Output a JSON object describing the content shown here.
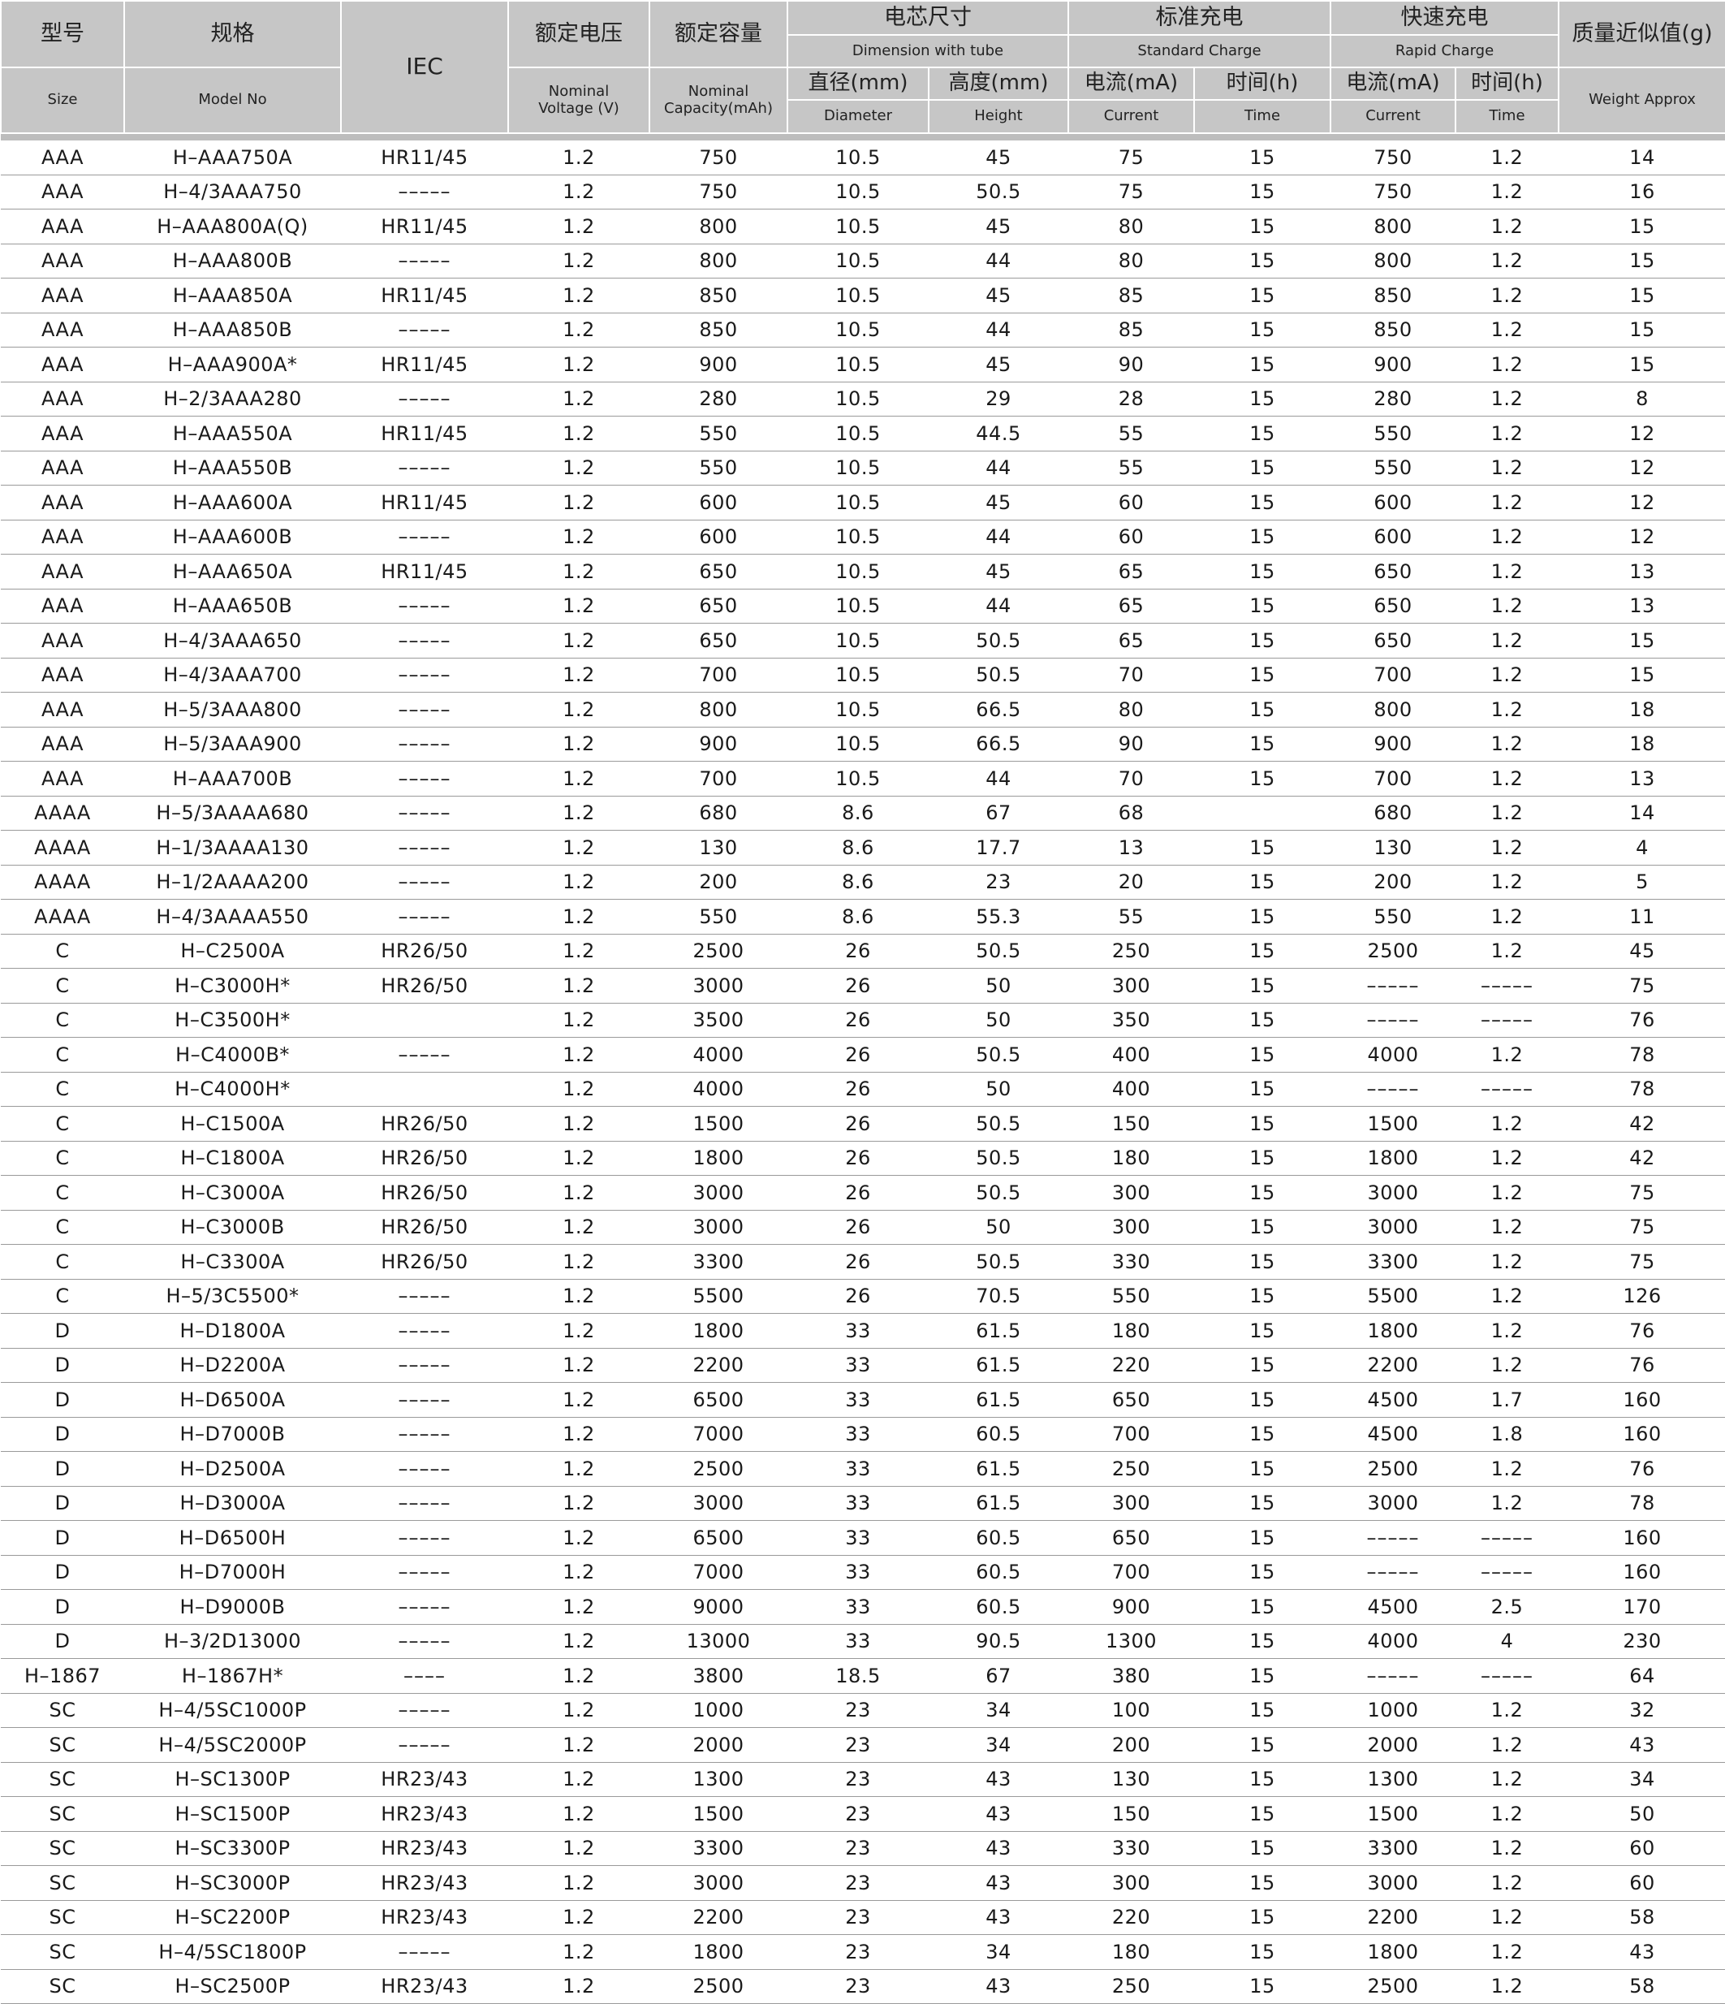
{
  "header": {
    "size_zh": "型号",
    "size_en": "Size",
    "model_zh": "规格",
    "model_en": "Model No",
    "iec": "IEC",
    "voltage_zh": "额定电压",
    "voltage_en_1": "Nominal",
    "voltage_en_2": "Voltage (V)",
    "capacity_zh": "额定容量",
    "capacity_en_1": "Nominal",
    "capacity_en_2": "Capacity(mAh)",
    "dimension_zh": "电芯尺寸",
    "dimension_en": "Dimension with tube",
    "diameter_zh": "直径(mm)",
    "diameter_en": "Diameter",
    "height_zh": "高度(mm)",
    "height_en": "Height",
    "standard_zh": "标准充电",
    "standard_en": "Standard Charge",
    "std_current_zh": "电流(mA)",
    "std_current_en": "Current",
    "std_time_zh": "时间(h)",
    "std_time_en": "Time",
    "rapid_zh": "快速充电",
    "rapid_en": "Rapid Charge",
    "rap_current_zh": "电流(mA)",
    "rap_current_en": "Current",
    "rap_time_zh": "时间(h)",
    "rap_time_en": "Time",
    "weight_zh": "质量近似值(g)",
    "weight_en": "Weight Approx"
  },
  "rows": [
    [
      "AAA",
      "H–AAA750A",
      "HR11/45",
      "1.2",
      "750",
      "10.5",
      "45",
      "75",
      "15",
      "750",
      "1.2",
      "14"
    ],
    [
      "AAA",
      "H–4/3AAA750",
      "–––––",
      "1.2",
      "750",
      "10.5",
      "50.5",
      "75",
      "15",
      "750",
      "1.2",
      "16"
    ],
    [
      "AAA",
      "H–AAA800A(Q)",
      "HR11/45",
      "1.2",
      "800",
      "10.5",
      "45",
      "80",
      "15",
      "800",
      "1.2",
      "15"
    ],
    [
      "AAA",
      "H–AAA800B",
      "–––––",
      "1.2",
      "800",
      "10.5",
      "44",
      "80",
      "15",
      "800",
      "1.2",
      "15"
    ],
    [
      "AAA",
      "H–AAA850A",
      "HR11/45",
      "1.2",
      "850",
      "10.5",
      "45",
      "85",
      "15",
      "850",
      "1.2",
      "15"
    ],
    [
      "AAA",
      "H–AAA850B",
      "–––––",
      "1.2",
      "850",
      "10.5",
      "44",
      "85",
      "15",
      "850",
      "1.2",
      "15"
    ],
    [
      "AAA",
      "H–AAA900A*",
      "HR11/45",
      "1.2",
      "900",
      "10.5",
      "45",
      "90",
      "15",
      "900",
      "1.2",
      "15"
    ],
    [
      "AAA",
      "H–2/3AAA280",
      "–––––",
      "1.2",
      "280",
      "10.5",
      "29",
      "28",
      "15",
      "280",
      "1.2",
      "8"
    ],
    [
      "AAA",
      "H–AAA550A",
      "HR11/45",
      "1.2",
      "550",
      "10.5",
      "44.5",
      "55",
      "15",
      "550",
      "1.2",
      "12"
    ],
    [
      "AAA",
      "H–AAA550B",
      "–––––",
      "1.2",
      "550",
      "10.5",
      "44",
      "55",
      "15",
      "550",
      "1.2",
      "12"
    ],
    [
      "AAA",
      "H–AAA600A",
      "HR11/45",
      "1.2",
      "600",
      "10.5",
      "45",
      "60",
      "15",
      "600",
      "1.2",
      "12"
    ],
    [
      "AAA",
      "H–AAA600B",
      "–––––",
      "1.2",
      "600",
      "10.5",
      "44",
      "60",
      "15",
      "600",
      "1.2",
      "12"
    ],
    [
      "AAA",
      "H–AAA650A",
      "HR11/45",
      "1.2",
      "650",
      "10.5",
      "45",
      "65",
      "15",
      "650",
      "1.2",
      "13"
    ],
    [
      "AAA",
      "H–AAA650B",
      "–––––",
      "1.2",
      "650",
      "10.5",
      "44",
      "65",
      "15",
      "650",
      "1.2",
      "13"
    ],
    [
      "AAA",
      "H–4/3AAA650",
      "–––––",
      "1.2",
      "650",
      "10.5",
      "50.5",
      "65",
      "15",
      "650",
      "1.2",
      "15"
    ],
    [
      "AAA",
      "H–4/3AAA700",
      "–––––",
      "1.2",
      "700",
      "10.5",
      "50.5",
      "70",
      "15",
      "700",
      "1.2",
      "15"
    ],
    [
      "AAA",
      "H–5/3AAA800",
      "–––––",
      "1.2",
      "800",
      "10.5",
      "66.5",
      "80",
      "15",
      "800",
      "1.2",
      "18"
    ],
    [
      "AAA",
      "H–5/3AAA900",
      "–––––",
      "1.2",
      "900",
      "10.5",
      "66.5",
      "90",
      "15",
      "900",
      "1.2",
      "18"
    ],
    [
      "AAA",
      "H–AAA700B",
      "–––––",
      "1.2",
      "700",
      "10.5",
      "44",
      "70",
      "15",
      "700",
      "1.2",
      "13"
    ],
    [
      "AAAA",
      "H–5/3AAAA680",
      "–––––",
      "1.2",
      "680",
      "8.6",
      "67",
      "68",
      "",
      "680",
      "1.2",
      "14"
    ],
    [
      "AAAA",
      "H–1/3AAAA130",
      "–––––",
      "1.2",
      "130",
      "8.6",
      "17.7",
      "13",
      "15",
      "130",
      "1.2",
      "4"
    ],
    [
      "AAAA",
      "H–1/2AAAA200",
      "–––––",
      "1.2",
      "200",
      "8.6",
      "23",
      "20",
      "15",
      "200",
      "1.2",
      "5"
    ],
    [
      "AAAA",
      "H–4/3AAAA550",
      "–––––",
      "1.2",
      "550",
      "8.6",
      "55.3",
      "55",
      "15",
      "550",
      "1.2",
      "11"
    ],
    [
      "C",
      "H–C2500A",
      "HR26/50",
      "1.2",
      "2500",
      "26",
      "50.5",
      "250",
      "15",
      "2500",
      "1.2",
      "45"
    ],
    [
      "C",
      "H–C3000H*",
      "HR26/50",
      "1.2",
      "3000",
      "26",
      "50",
      "300",
      "15",
      "–––––",
      "–––––",
      "75"
    ],
    [
      "C",
      "H–C3500H*",
      "",
      "1.2",
      "3500",
      "26",
      "50",
      "350",
      "15",
      "–––––",
      "–––––",
      "76"
    ],
    [
      "C",
      "H–C4000B*",
      "–––––",
      "1.2",
      "4000",
      "26",
      "50.5",
      "400",
      "15",
      "4000",
      "1.2",
      "78"
    ],
    [
      "C",
      "H–C4000H*",
      "",
      "1.2",
      "4000",
      "26",
      "50",
      "400",
      "15",
      "–––––",
      "–––––",
      "78"
    ],
    [
      "C",
      "H–C1500A",
      "HR26/50",
      "1.2",
      "1500",
      "26",
      "50.5",
      "150",
      "15",
      "1500",
      "1.2",
      "42"
    ],
    [
      "C",
      "H–C1800A",
      "HR26/50",
      "1.2",
      "1800",
      "26",
      "50.5",
      "180",
      "15",
      "1800",
      "1.2",
      "42"
    ],
    [
      "C",
      "H–C3000A",
      "HR26/50",
      "1.2",
      "3000",
      "26",
      "50.5",
      "300",
      "15",
      "3000",
      "1.2",
      "75"
    ],
    [
      "C",
      "H–C3000B",
      "HR26/50",
      "1.2",
      "3000",
      "26",
      "50",
      "300",
      "15",
      "3000",
      "1.2",
      "75"
    ],
    [
      "C",
      "H–C3300A",
      "HR26/50",
      "1.2",
      "3300",
      "26",
      "50.5",
      "330",
      "15",
      "3300",
      "1.2",
      "75"
    ],
    [
      "C",
      "H–5/3C5500*",
      "–––––",
      "1.2",
      "5500",
      "26",
      "70.5",
      "550",
      "15",
      "5500",
      "1.2",
      "126"
    ],
    [
      "D",
      "H–D1800A",
      "–––––",
      "1.2",
      "1800",
      "33",
      "61.5",
      "180",
      "15",
      "1800",
      "1.2",
      "76"
    ],
    [
      "D",
      "H–D2200A",
      "–––––",
      "1.2",
      "2200",
      "33",
      "61.5",
      "220",
      "15",
      "2200",
      "1.2",
      "76"
    ],
    [
      "D",
      "H–D6500A",
      "–––––",
      "1.2",
      "6500",
      "33",
      "61.5",
      "650",
      "15",
      "4500",
      "1.7",
      "160"
    ],
    [
      "D",
      "H–D7000B",
      "–––––",
      "1.2",
      "7000",
      "33",
      "60.5",
      "700",
      "15",
      "4500",
      "1.8",
      "160"
    ],
    [
      "D",
      "H–D2500A",
      "–––––",
      "1.2",
      "2500",
      "33",
      "61.5",
      "250",
      "15",
      "2500",
      "1.2",
      "76"
    ],
    [
      "D",
      "H–D3000A",
      "–––––",
      "1.2",
      "3000",
      "33",
      "61.5",
      "300",
      "15",
      "3000",
      "1.2",
      "78"
    ],
    [
      "D",
      "H–D6500H",
      "–––––",
      "1.2",
      "6500",
      "33",
      "60.5",
      "650",
      "15",
      "–––––",
      "–––––",
      "160"
    ],
    [
      "D",
      "H–D7000H",
      "–––––",
      "1.2",
      "7000",
      "33",
      "60.5",
      "700",
      "15",
      "–––––",
      "–––––",
      "160"
    ],
    [
      "D",
      "H–D9000B",
      "–––––",
      "1.2",
      "9000",
      "33",
      "60.5",
      "900",
      "15",
      "4500",
      "2.5",
      "170"
    ],
    [
      "D",
      "H–3/2D13000",
      "–––––",
      "1.2",
      "13000",
      "33",
      "90.5",
      "1300",
      "15",
      "4000",
      "4",
      "230"
    ],
    [
      "H–1867",
      "H–1867H*",
      "––––",
      "1.2",
      "3800",
      "18.5",
      "67",
      "380",
      "15",
      "–––––",
      "–––––",
      "64"
    ],
    [
      "SC",
      "H–4/5SC1000P",
      "–––––",
      "1.2",
      "1000",
      "23",
      "34",
      "100",
      "15",
      "1000",
      "1.2",
      "32"
    ],
    [
      "SC",
      "H–4/5SC2000P",
      "–––––",
      "1.2",
      "2000",
      "23",
      "34",
      "200",
      "15",
      "2000",
      "1.2",
      "43"
    ],
    [
      "SC",
      "H–SC1300P",
      "HR23/43",
      "1.2",
      "1300",
      "23",
      "43",
      "130",
      "15",
      "1300",
      "1.2",
      "34"
    ],
    [
      "SC",
      "H–SC1500P",
      "HR23/43",
      "1.2",
      "1500",
      "23",
      "43",
      "150",
      "15",
      "1500",
      "1.2",
      "50"
    ],
    [
      "SC",
      "H–SC3300P",
      "HR23/43",
      "1.2",
      "3300",
      "23",
      "43",
      "330",
      "15",
      "3300",
      "1.2",
      "60"
    ],
    [
      "SC",
      "H–SC3000P",
      "HR23/43",
      "1.2",
      "3000",
      "23",
      "43",
      "300",
      "15",
      "3000",
      "1.2",
      "60"
    ],
    [
      "SC",
      "H–SC2200P",
      "HR23/43",
      "1.2",
      "2200",
      "23",
      "43",
      "220",
      "15",
      "2200",
      "1.2",
      "58"
    ],
    [
      "SC",
      "H–4/5SC1800P",
      "–––––",
      "1.2",
      "1800",
      "23",
      "34",
      "180",
      "15",
      "1800",
      "1.2",
      "43"
    ],
    [
      "SC",
      "H–SC2500P",
      "HR23/43",
      "1.2",
      "2500",
      "23",
      "43",
      "250",
      "15",
      "2500",
      "1.2",
      "58"
    ]
  ]
}
